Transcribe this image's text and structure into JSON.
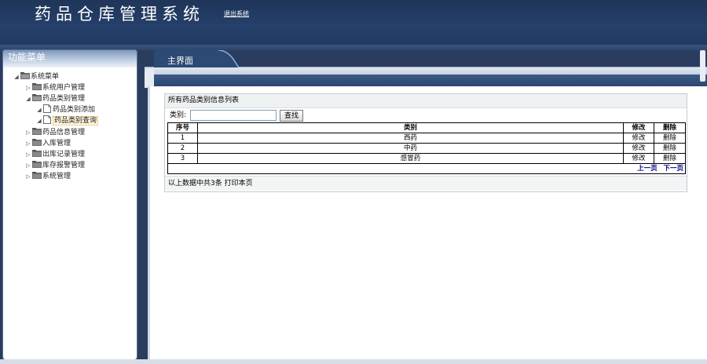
{
  "header": {
    "title": "药品仓库管理系统",
    "logout_label": "退出系统"
  },
  "sidebar": {
    "title": "功能菜单",
    "root_label": "系统菜单",
    "items": [
      {
        "label": "系统用户管理"
      },
      {
        "label": "药品类别管理"
      },
      {
        "label": "药品类别添加"
      },
      {
        "label": "药品类别查询"
      },
      {
        "label": "药品信息管理"
      },
      {
        "label": "入库管理"
      },
      {
        "label": "出库记录管理"
      },
      {
        "label": "库存报警管理"
      },
      {
        "label": "系统管理"
      }
    ]
  },
  "main": {
    "tab_label": "主界面",
    "section_title": "所有药品类别信息列表",
    "search": {
      "label": "类别:",
      "value": "",
      "button_label": "查找"
    },
    "table": {
      "headers": [
        "序号",
        "类别",
        "修改",
        "删除"
      ],
      "rows": [
        {
          "no": "1",
          "category": "西药",
          "edit": "修改",
          "delete": "删除"
        },
        {
          "no": "2",
          "category": "中药",
          "edit": "修改",
          "delete": "删除"
        },
        {
          "no": "3",
          "category": "感冒药",
          "edit": "修改",
          "delete": "删除"
        }
      ]
    },
    "pager": {
      "prev_label": "上一页",
      "next_label": "下一页"
    },
    "summary": "以上数据中共3条 打印本页"
  }
}
